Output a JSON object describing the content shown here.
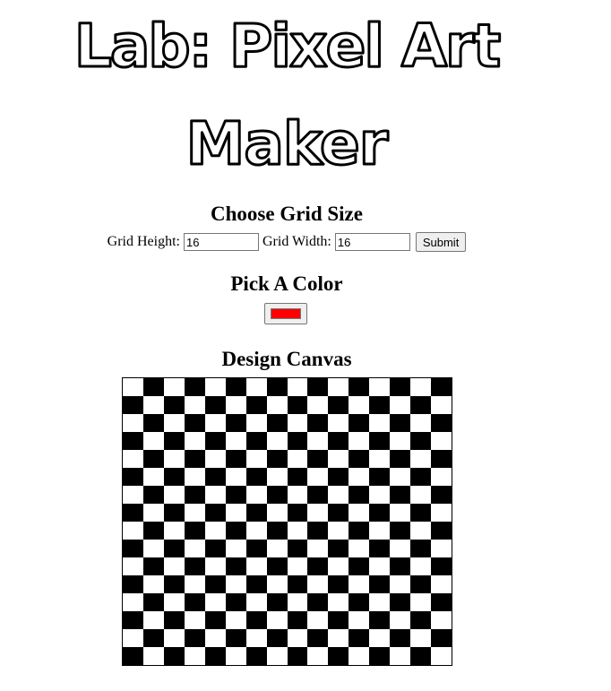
{
  "title": {
    "line1": "Lab: Pixel Art",
    "line2": "Maker"
  },
  "grid_size": {
    "heading": "Choose Grid Size",
    "height_label": "Grid Height:",
    "height_value": "16",
    "width_label": "Grid Width:",
    "width_value": "16",
    "submit_label": "Submit"
  },
  "color": {
    "heading": "Pick A Color",
    "value": "#ff0000"
  },
  "canvas": {
    "heading": "Design Canvas",
    "rows": 16,
    "cols": 16,
    "pattern": "checkerboard",
    "dark_color": "#000000",
    "light_color": "#ffffff"
  }
}
